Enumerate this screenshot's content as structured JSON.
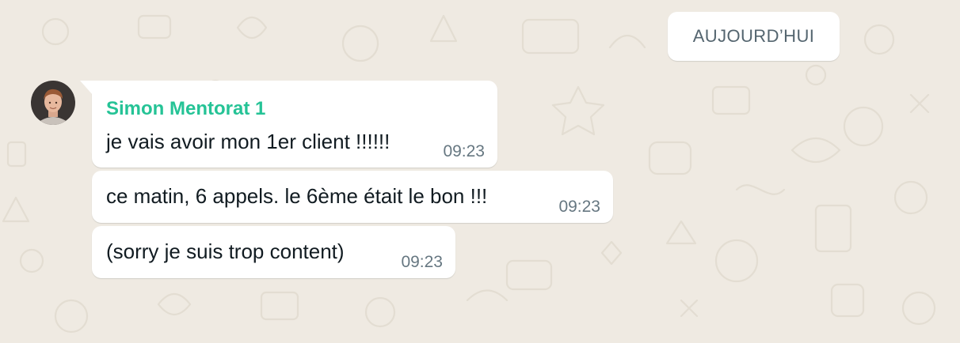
{
  "date_divider": {
    "label": "AUJOURD’HUI"
  },
  "sender": {
    "name": "Simon Mentorat 1",
    "name_color": "#25c396",
    "avatar": "user-avatar-photo"
  },
  "messages": [
    {
      "text": "je vais avoir mon 1er client !!!!!!",
      "time": "09:23"
    },
    {
      "text": "ce matin, 6 appels. le 6ème était le bon !!!",
      "time": "09:23"
    },
    {
      "text": "(sorry je suis trop content)",
      "time": "09:23"
    }
  ],
  "colors": {
    "chat_background": "#efeae2",
    "bubble": "#ffffff",
    "text": "#111b21",
    "timestamp": "#667781"
  }
}
